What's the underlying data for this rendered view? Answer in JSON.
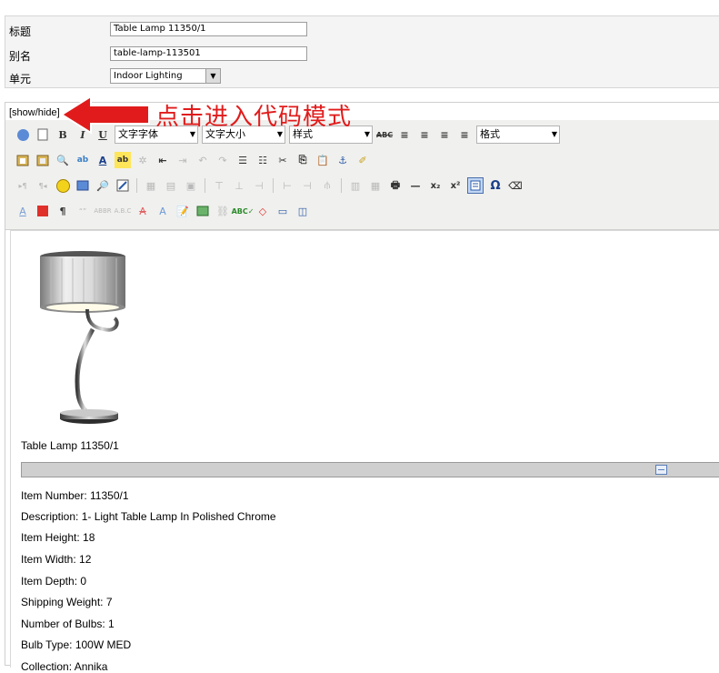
{
  "form": {
    "title_label": "标题",
    "title_value": "Table Lamp 11350/1",
    "alias_label": "别名",
    "alias_value": "table-lamp-113501",
    "unit_label": "单元",
    "unit_value": "Indoor Lighting"
  },
  "editor": {
    "show_hide": "[show/hide]",
    "font_family_select": "文字字体",
    "font_size_select": "文字大小",
    "style_select": "样式",
    "format_select": "格式"
  },
  "annotation": {
    "text": "点击进入代码模式",
    "color": "#e11b1b"
  },
  "content": {
    "caption": "Table Lamp 11350/1",
    "details": [
      "Item Number: 11350/1",
      "Description: 1- Light Table Lamp In Polished Chrome",
      "Item Height: 18",
      "Item Width: 12",
      "Item Depth: 0",
      "Shipping Weight: 7",
      "Number of Bulbs: 1",
      "Bulb Type: 100W MED",
      "Collection: Annika"
    ]
  },
  "colors": {
    "toolbar_bg": "#f0f0ee",
    "arrow": "#e11b1b"
  }
}
